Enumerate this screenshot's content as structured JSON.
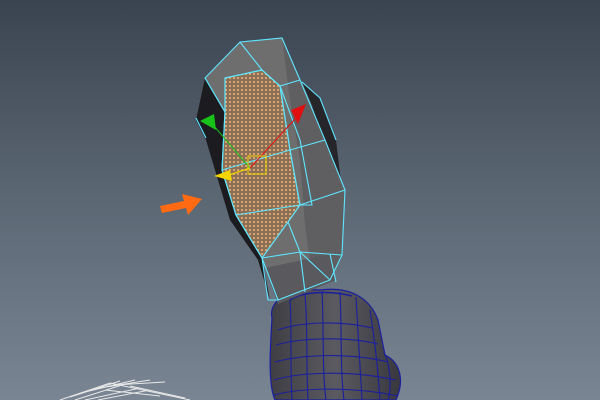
{
  "viewport": {
    "background_top": "#3a4350",
    "background_bottom": "#7a8593",
    "selection_wire_color": "#5fe6ff",
    "body_wire_color": "#1b1f9e",
    "selected_faces_color": "#d49a6a",
    "mesh_color": "#6e6e6e",
    "grid_color": "#e8e8e8",
    "callout_color": "#ff6a12"
  },
  "manipulator": {
    "x_axis_color": "#e01010",
    "y_axis_color": "#19c219",
    "z_axis_color": "#f1d400",
    "center_color": "#f1d400",
    "x_axis_icon": "red-cone-arrow",
    "y_axis_icon": "green-cone-arrow",
    "z_axis_icon": "yellow-cone-arrow"
  },
  "annotation": {
    "icon": "orange-arrow",
    "points_to": "selected-face-region"
  }
}
